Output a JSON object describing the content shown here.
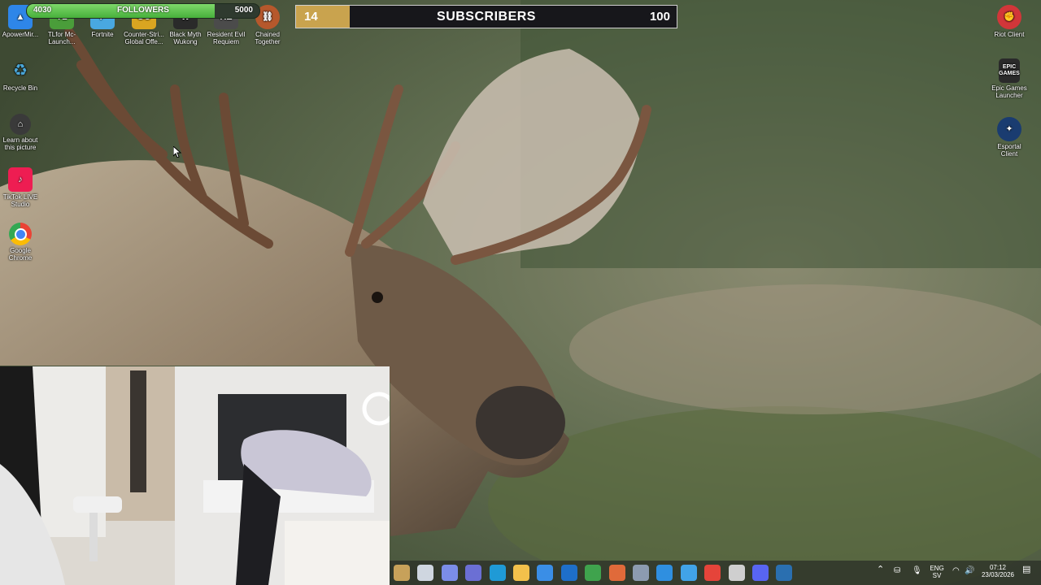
{
  "desktop_icons_left_top": [
    {
      "label": "ApowerMir...",
      "icon": "apowermirror-icon",
      "color": "#2e86e8"
    },
    {
      "label": "TLfor Mc-Launch...",
      "icon": "tlauncher-icon",
      "color": "#4a9d3a"
    },
    {
      "label": "Fortnite",
      "icon": "fortnite-icon",
      "color": "#49a8e0"
    },
    {
      "label": "Counter-Stri... Global Offe...",
      "icon": "csgo-icon",
      "color": "#d9a521"
    },
    {
      "label": "Black Myth Wukong",
      "icon": "black-myth-icon",
      "color": "#2a2a2a"
    },
    {
      "label": "Resident Evil Requiem",
      "icon": "resident-evil-icon",
      "color": "#4b4b4b"
    },
    {
      "label": "Chained Together",
      "icon": "chained-together-icon",
      "color": "#b6582c"
    }
  ],
  "desktop_icons_left_column": [
    {
      "label": "Recycle Bin",
      "icon": "recycle-bin-icon",
      "color": "#4aa6d8"
    },
    {
      "label": "Learn about this picture",
      "icon": "learn-about-picture-icon",
      "color": "#3a3a3a"
    },
    {
      "label": "TikTok LIVE Studio",
      "icon": "tiktok-live-studio-icon",
      "color": "#ee1d52"
    },
    {
      "label": "Google Chrome",
      "icon": "google-chrome-icon",
      "color": "#34a853"
    }
  ],
  "desktop_icons_right_column": [
    {
      "label": "Riot Client",
      "icon": "riot-client-icon",
      "color": "#d13639",
      "text": ""
    },
    {
      "label": "Epic Games Launcher",
      "icon": "epic-games-icon",
      "color": "#2a2a2a",
      "text": "EPIC GAMES"
    },
    {
      "label": "Esportal Client",
      "icon": "esportal-icon",
      "color": "#1a3c70",
      "text": ""
    }
  ],
  "followers_goal": {
    "current": "4030",
    "label": "FOLLOWERS",
    "target": "5000",
    "progress": 0.806,
    "color": "#5cc34b"
  },
  "subscribers_goal": {
    "current": "14",
    "label": "SUBSCRIBERS",
    "target": "100",
    "progress": 0.14,
    "color": "#c9a34e"
  },
  "taskbar": {
    "apps": [
      {
        "name": "start-icon",
        "color": "#c7a15a"
      },
      {
        "name": "task-view-icon",
        "color": "#cfd6e0"
      },
      {
        "name": "copilot-icon",
        "color": "#7b8de8"
      },
      {
        "name": "teams-icon",
        "color": "#6b6fd4"
      },
      {
        "name": "edge-icon",
        "color": "#1f9ad6"
      },
      {
        "name": "file-explorer-icon",
        "color": "#f3c14b"
      },
      {
        "name": "microsoft-store-icon",
        "color": "#3a8ee6"
      },
      {
        "name": "outlook-icon",
        "color": "#1e6fc9"
      },
      {
        "name": "vpn-icon",
        "color": "#3fa34d"
      },
      {
        "name": "microsoft-365-icon",
        "color": "#e06a3a"
      },
      {
        "name": "app-hex-icon",
        "color": "#8c9bb0"
      },
      {
        "name": "photos-icon",
        "color": "#2f8fe0"
      },
      {
        "name": "snipping-icon",
        "color": "#41a3e8"
      },
      {
        "name": "chrome-taskbar-icon",
        "color": "#e5443a"
      },
      {
        "name": "obs-icon",
        "color": "#cfcfcf"
      },
      {
        "name": "discord-icon",
        "color": "#5865f2"
      },
      {
        "name": "steam-icon",
        "color": "#2a6fb0"
      }
    ],
    "language": {
      "line1": "ENG",
      "line2": "SV"
    },
    "time": "07:12",
    "date": "23/03/2026"
  }
}
